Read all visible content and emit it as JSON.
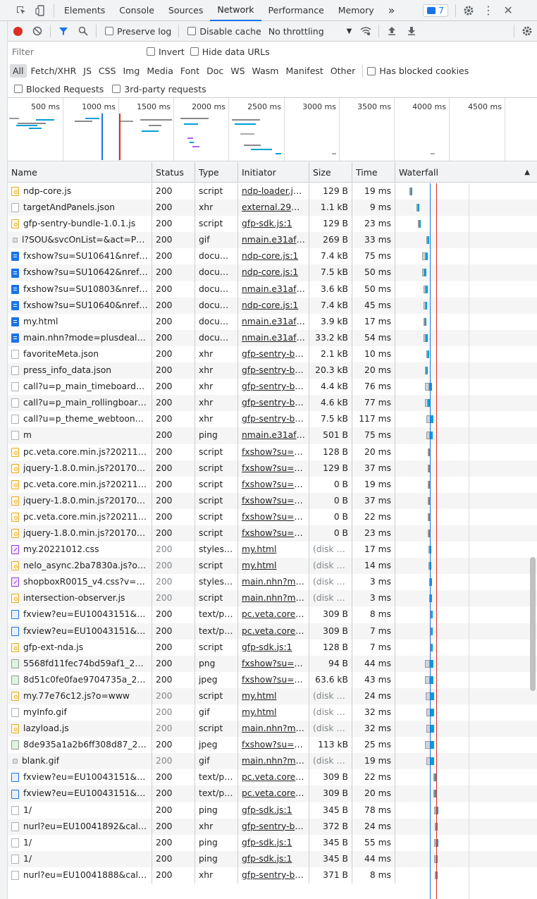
{
  "tabbar": {
    "tabs": [
      {
        "label": "Elements",
        "selected": false
      },
      {
        "label": "Console",
        "selected": false
      },
      {
        "label": "Sources",
        "selected": false
      },
      {
        "label": "Network",
        "selected": true
      },
      {
        "label": "Performance",
        "selected": false
      },
      {
        "label": "Memory",
        "selected": false
      }
    ],
    "more_label": "»",
    "issues_count": "7"
  },
  "toolbar": {
    "preserve_log": "Preserve log",
    "disable_cache": "Disable cache",
    "throttling": "No throttling"
  },
  "filter": {
    "placeholder": "Filter",
    "invert": "Invert",
    "hide_data_urls": "Hide data URLs",
    "types": [
      "All",
      "Fetch/XHR",
      "JS",
      "CSS",
      "Img",
      "Media",
      "Font",
      "Doc",
      "WS",
      "Wasm",
      "Manifest",
      "Other"
    ],
    "has_blocked_cookies": "Has blocked cookies",
    "blocked_requests": "Blocked Requests",
    "third_party": "3rd-party requests"
  },
  "overview": {
    "ticks": [
      "500 ms",
      "1000 ms",
      "1500 ms",
      "2000 ms",
      "2500 ms",
      "3000 ms",
      "3500 ms",
      "4000 ms",
      "4500 ms",
      "50"
    ]
  },
  "columns": {
    "name": "Name",
    "status": "Status",
    "type": "Type",
    "initiator": "Initiator",
    "size": "Size",
    "time": "Time",
    "waterfall": "Waterfall"
  },
  "colors": {
    "accent": "#1a73e8",
    "record": "#d93025",
    "dom_content_loaded": "#1a73e8",
    "load": "#d93025",
    "download": "#00a0d6"
  },
  "requests": [
    {
      "name": "ndp-core.js",
      "icon": "script",
      "status": "200",
      "type": "script",
      "initiator": "ndp-loader.js:1",
      "size": "129 B",
      "time": "19 ms",
      "cached": false,
      "wf": [
        0.1,
        0.02
      ]
    },
    {
      "name": "targetAndPanels.json",
      "icon": "file",
      "status": "200",
      "type": "xhr",
      "initiator": "external.2961...",
      "size": "1.1 kB",
      "time": "9 ms",
      "cached": false,
      "wf": [
        0.15,
        0.01
      ]
    },
    {
      "name": "gfp-sentry-bundle-1.0.1.js",
      "icon": "script",
      "status": "200",
      "type": "script",
      "initiator": "gfp-sdk.js:1",
      "size": "129 B",
      "time": "23 ms",
      "cached": false,
      "wf": [
        0.16,
        0.02
      ]
    },
    {
      "name": "l?SOU&svcOnList=&act=PC...",
      "icon": "gifdot",
      "status": "200",
      "type": "gif",
      "initiator": "nmain.e31af4...",
      "size": "269 B",
      "time": "33 ms",
      "cached": false,
      "wf": [
        0.22,
        0.01
      ]
    },
    {
      "name": "fxshow?su=SU10641&nrefr...",
      "icon": "doc",
      "status": "200",
      "type": "docum...",
      "initiator": "ndp-core.js:1",
      "size": "7.4 kB",
      "time": "75 ms",
      "cached": false,
      "wf": [
        0.19,
        0.04
      ]
    },
    {
      "name": "fxshow?su=SU10642&nrefr...",
      "icon": "doc",
      "status": "200",
      "type": "docum...",
      "initiator": "ndp-core.js:1",
      "size": "7.5 kB",
      "time": "50 ms",
      "cached": false,
      "wf": [
        0.19,
        0.03
      ]
    },
    {
      "name": "fxshow?su=SU10803&nrefr...",
      "icon": "doc",
      "status": "200",
      "type": "docum...",
      "initiator": "nmain.e31af4...",
      "size": "3.6 kB",
      "time": "50 ms",
      "cached": false,
      "wf": [
        0.2,
        0.03
      ]
    },
    {
      "name": "fxshow?su=SU10640&nrefr...",
      "icon": "doc",
      "status": "200",
      "type": "docum...",
      "initiator": "ndp-core.js:1",
      "size": "7.4 kB",
      "time": "45 ms",
      "cached": false,
      "wf": [
        0.2,
        0.025
      ]
    },
    {
      "name": "my.html",
      "icon": "doc",
      "status": "200",
      "type": "docum...",
      "initiator": "nmain.e31af4...",
      "size": "3.9 kB",
      "time": "17 ms",
      "cached": false,
      "wf": [
        0.2,
        0.015
      ]
    },
    {
      "name": "main.nhn?mode=plusdeal&...",
      "icon": "doc",
      "status": "200",
      "type": "docum...",
      "initiator": "nmain.e31af4...",
      "size": "33.2 kB",
      "time": "54 ms",
      "cached": false,
      "wf": [
        0.2,
        0.03
      ]
    },
    {
      "name": "favoriteMeta.json",
      "icon": "file",
      "status": "200",
      "type": "xhr",
      "initiator": "gfp-sentry-bu...",
      "size": "2.1 kB",
      "time": "10 ms",
      "cached": false,
      "wf": [
        0.22,
        0.01
      ]
    },
    {
      "name": "press_info_data.json",
      "icon": "file",
      "status": "200",
      "type": "xhr",
      "initiator": "gfp-sentry-bu...",
      "size": "20.3 kB",
      "time": "20 ms",
      "cached": false,
      "wf": [
        0.21,
        0.015
      ]
    },
    {
      "name": "call?u=p_main_timeboard&...",
      "icon": "file",
      "status": "200",
      "type": "xhr",
      "initiator": "gfp-sentry-bu...",
      "size": "4.4 kB",
      "time": "76 ms",
      "cached": false,
      "wf": [
        0.21,
        0.05
      ]
    },
    {
      "name": "call?u=p_main_rollingboard...",
      "icon": "file",
      "status": "200",
      "type": "xhr",
      "initiator": "gfp-sentry-bu...",
      "size": "4.6 kB",
      "time": "77 ms",
      "cached": false,
      "wf": [
        0.21,
        0.035
      ]
    },
    {
      "name": "call?u=p_theme_webtoon&...",
      "icon": "file",
      "status": "200",
      "type": "xhr",
      "initiator": "gfp-sentry-bu...",
      "size": "7.5 kB",
      "time": "117 ms",
      "cached": false,
      "wf": [
        0.22,
        0.05
      ]
    },
    {
      "name": "m",
      "icon": "file",
      "status": "200",
      "type": "ping",
      "initiator": "nmain.e31af4...",
      "size": "501 B",
      "time": "75 ms",
      "cached": false,
      "wf": [
        0.22,
        0.045
      ]
    },
    {
      "name": "pc.veta.core.min.js?20211105",
      "icon": "script",
      "status": "200",
      "type": "script",
      "initiator": "fxshow?su=S...",
      "size": "128 B",
      "time": "20 ms",
      "cached": false,
      "wf": [
        0.23,
        0.015
      ]
    },
    {
      "name": "jquery-1.8.0.min.js?20170206",
      "icon": "script",
      "status": "200",
      "type": "script",
      "initiator": "fxshow?su=S...",
      "size": "129 B",
      "time": "37 ms",
      "cached": false,
      "wf": [
        0.23,
        0.02
      ]
    },
    {
      "name": "pc.veta.core.min.js?20211105",
      "icon": "script",
      "status": "200",
      "type": "script",
      "initiator": "fxshow?su=S...",
      "size": "0 B",
      "time": "19 ms",
      "cached": false,
      "wf": [
        0.23,
        0.015
      ]
    },
    {
      "name": "jquery-1.8.0.min.js?20170206",
      "icon": "script",
      "status": "200",
      "type": "script",
      "initiator": "fxshow?su=S...",
      "size": "0 B",
      "time": "37 ms",
      "cached": false,
      "wf": [
        0.23,
        0.02
      ]
    },
    {
      "name": "pc.veta.core.min.js?20211105",
      "icon": "script",
      "status": "200",
      "type": "script",
      "initiator": "fxshow?su=S...",
      "size": "0 B",
      "time": "22 ms",
      "cached": false,
      "wf": [
        0.23,
        0.015
      ]
    },
    {
      "name": "jquery-1.8.0.min.js?20170206",
      "icon": "script",
      "status": "200",
      "type": "script",
      "initiator": "fxshow?su=S...",
      "size": "0 B",
      "time": "23 ms",
      "cached": false,
      "wf": [
        0.23,
        0.015
      ]
    },
    {
      "name": "my.20221012.css",
      "icon": "css",
      "status": "200",
      "type": "stylesh...",
      "initiator": "my.html",
      "size": "(disk c...",
      "time": "17 ms",
      "cached": true,
      "wf": [
        0.235,
        0.01
      ]
    },
    {
      "name": "nelo_async.2ba7830a.js?o=...",
      "icon": "script",
      "status": "200",
      "type": "script",
      "initiator": "my.html",
      "size": "(disk c...",
      "time": "14 ms",
      "cached": true,
      "wf": [
        0.235,
        0.01
      ]
    },
    {
      "name": "shopboxR0015_v4.css?v=20...",
      "icon": "css",
      "status": "200",
      "type": "stylesh...",
      "initiator": "main.nhn?mo...",
      "size": "(disk c...",
      "time": "3 ms",
      "cached": true,
      "wf": [
        0.24,
        0.005
      ]
    },
    {
      "name": "intersection-observer.js",
      "icon": "script",
      "status": "200",
      "type": "script",
      "initiator": "main.nhn?mo...",
      "size": "(disk c...",
      "time": "3 ms",
      "cached": true,
      "wf": [
        0.24,
        0.005
      ]
    },
    {
      "name": "fxview?eu=EU10043151&ca...",
      "icon": "text",
      "status": "200",
      "type": "text/pl...",
      "initiator": "pc.veta.core....",
      "size": "309 B",
      "time": "8 ms",
      "cached": false,
      "wf": [
        0.245,
        0.005
      ]
    },
    {
      "name": "fxview?eu=EU10043151&ca...",
      "icon": "text",
      "status": "200",
      "type": "text/pl...",
      "initiator": "pc.veta.core....",
      "size": "309 B",
      "time": "7 ms",
      "cached": false,
      "wf": [
        0.245,
        0.005
      ]
    },
    {
      "name": "gfp-ext-nda.js",
      "icon": "script",
      "status": "200",
      "type": "script",
      "initiator": "gfp-sdk.js:1",
      "size": "128 B",
      "time": "7 ms",
      "cached": false,
      "wf": [
        0.245,
        0.005
      ]
    },
    {
      "name": "5568fd11fec74bd59af1_202...",
      "icon": "img",
      "status": "200",
      "type": "png",
      "initiator": "fxshow?su=S...",
      "size": "94 B",
      "time": "44 ms",
      "cached": false,
      "wf": [
        0.21,
        0.06
      ]
    },
    {
      "name": "8d51c0fe0fae9704735a_202...",
      "icon": "img",
      "status": "200",
      "type": "jpeg",
      "initiator": "fxshow?su=S...",
      "size": "63.6 kB",
      "time": "43 ms",
      "cached": false,
      "wf": [
        0.21,
        0.06
      ]
    },
    {
      "name": "my.77e76c12.js?o=www",
      "icon": "script",
      "status": "200",
      "type": "script",
      "initiator": "my.html",
      "size": "(disk c...",
      "time": "24 ms",
      "cached": true,
      "wf": [
        0.215,
        0.06
      ]
    },
    {
      "name": "myInfo.gif",
      "icon": "file",
      "status": "200",
      "type": "gif",
      "initiator": "my.html",
      "size": "(disk c...",
      "time": "32 ms",
      "cached": true,
      "wf": [
        0.22,
        0.055
      ]
    },
    {
      "name": "lazyload.js",
      "icon": "script",
      "status": "200",
      "type": "script",
      "initiator": "main.nhn?mo...",
      "size": "(disk c...",
      "time": "32 ms",
      "cached": true,
      "wf": [
        0.22,
        0.055
      ]
    },
    {
      "name": "8de935a1a2b6ff308d87_20...",
      "icon": "img",
      "status": "200",
      "type": "jpeg",
      "initiator": "fxshow?su=S...",
      "size": "113 kB",
      "time": "25 ms",
      "cached": false,
      "wf": [
        0.21,
        0.065
      ]
    },
    {
      "name": "blank.gif",
      "icon": "gifdot",
      "status": "200",
      "type": "gif",
      "initiator": "main.nhn?mo...",
      "size": "(disk c...",
      "time": "19 ms",
      "cached": true,
      "wf": [
        0.22,
        0.055
      ]
    },
    {
      "name": "fxview?eu=EU10043151&ca...",
      "icon": "text",
      "status": "200",
      "type": "text/pl...",
      "initiator": "pc.veta.core....",
      "size": "309 B",
      "time": "22 ms",
      "cached": false,
      "wf": [
        0.27,
        0.01
      ]
    },
    {
      "name": "fxview?eu=EU10043151&ca...",
      "icon": "text",
      "status": "200",
      "type": "text/pl...",
      "initiator": "pc.veta.core....",
      "size": "309 B",
      "time": "20 ms",
      "cached": false,
      "wf": [
        0.27,
        0.01
      ]
    },
    {
      "name": "1/",
      "icon": "file",
      "status": "200",
      "type": "ping",
      "initiator": "gfp-sdk.js:1",
      "size": "345 B",
      "time": "78 ms",
      "cached": false,
      "wf": [
        0.275,
        0.03
      ]
    },
    {
      "name": "nurl?eu=EU10041892&calp...",
      "icon": "file",
      "status": "200",
      "type": "xhr",
      "initiator": "gfp-sentry-bu...",
      "size": "372 B",
      "time": "24 ms",
      "cached": false,
      "wf": [
        0.28,
        0.015
      ]
    },
    {
      "name": "1/",
      "icon": "file",
      "status": "200",
      "type": "ping",
      "initiator": "gfp-sdk.js:1",
      "size": "345 B",
      "time": "55 ms",
      "cached": false,
      "wf": [
        0.275,
        0.03
      ]
    },
    {
      "name": "1/",
      "icon": "file",
      "status": "200",
      "type": "ping",
      "initiator": "gfp-sdk.js:1",
      "size": "345 B",
      "time": "44 ms",
      "cached": false,
      "wf": [
        0.275,
        0.025
      ]
    },
    {
      "name": "nurl?eu=EU10041888&calp...",
      "icon": "file",
      "status": "200",
      "type": "xhr",
      "initiator": "gfp-sentry-bu...",
      "size": "371 B",
      "time": "8 ms",
      "cached": false,
      "wf": [
        0.28,
        0.01
      ]
    }
  ]
}
